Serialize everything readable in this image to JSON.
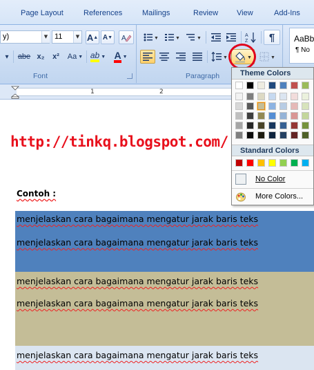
{
  "ribbon": {
    "tabs": [
      "Page Layout",
      "References",
      "Mailings",
      "Review",
      "View",
      "Add-Ins"
    ],
    "font_group": {
      "font_name": "y)",
      "font_size": "11",
      "label": "Font",
      "strike_label": "abe",
      "subscript_label": "x₂",
      "superscript_label": "x²",
      "change_case_label": "Aa",
      "grow_label": "A",
      "shrink_label": "A",
      "highlight_label": "ab",
      "font_color_label": "A"
    },
    "paragraph_group": {
      "label": "Paragraph",
      "show_marks_label": "¶"
    },
    "styles": {
      "preview": "AaBb",
      "name": "¶ No"
    }
  },
  "ruler": {
    "numbers": [
      "1",
      "2"
    ]
  },
  "document": {
    "url": "http://tinkq.blogspot.com/",
    "heading": "Contoh :",
    "lines": [
      "menjelaskan cara bagaimana mengatur jarak baris teks",
      "menjelaskan cara bagaimana mengatur jarak baris teks",
      "menjelaskan cara bagaimana mengatur jarak baris teks",
      "menjelaskan cara bagaimana mengatur jarak baris teks",
      "menjelaskan cara bagaimana mengatur jarak baris teks"
    ],
    "colors": {
      "url": "#e8101c",
      "band_blue": "#4f81bd",
      "band_tan": "#c4bd97",
      "band_light": "#dbe5f1"
    }
  },
  "shading_menu": {
    "theme_title": "Theme Colors",
    "standard_title": "Standard Colors",
    "no_color_label": "No Color",
    "more_colors_label": "More Colors...",
    "theme_top": [
      "#ffffff",
      "#000000",
      "#eeece1",
      "#1f497d",
      "#4f81bd",
      "#c0504d",
      "#9bbb59"
    ],
    "theme_shades": [
      [
        "#f2f2f2",
        "#7f7f7f",
        "#ddd9c3",
        "#c6d9f0",
        "#dbe5f1",
        "#f2dcdb",
        "#ebf1dd"
      ],
      [
        "#d8d8d8",
        "#595959",
        "#c4bd97",
        "#8db3e2",
        "#b8cce4",
        "#e5b9b7",
        "#d7e3bc"
      ],
      [
        "#bfbfbf",
        "#3f3f3f",
        "#938953",
        "#548dd4",
        "#95b3d7",
        "#d99694",
        "#c3d69b"
      ],
      [
        "#a5a5a5",
        "#262626",
        "#494429",
        "#17365d",
        "#366092",
        "#953734",
        "#76923c"
      ],
      [
        "#7f7f7f",
        "#0c0c0c",
        "#1d1b10",
        "#0f243e",
        "#244061",
        "#632423",
        "#4f6128"
      ]
    ],
    "standard": [
      "#c00000",
      "#ff0000",
      "#ffc000",
      "#ffff00",
      "#92d050",
      "#00b050",
      "#00b0f0"
    ],
    "selected_swatch": "#c4bd97"
  }
}
